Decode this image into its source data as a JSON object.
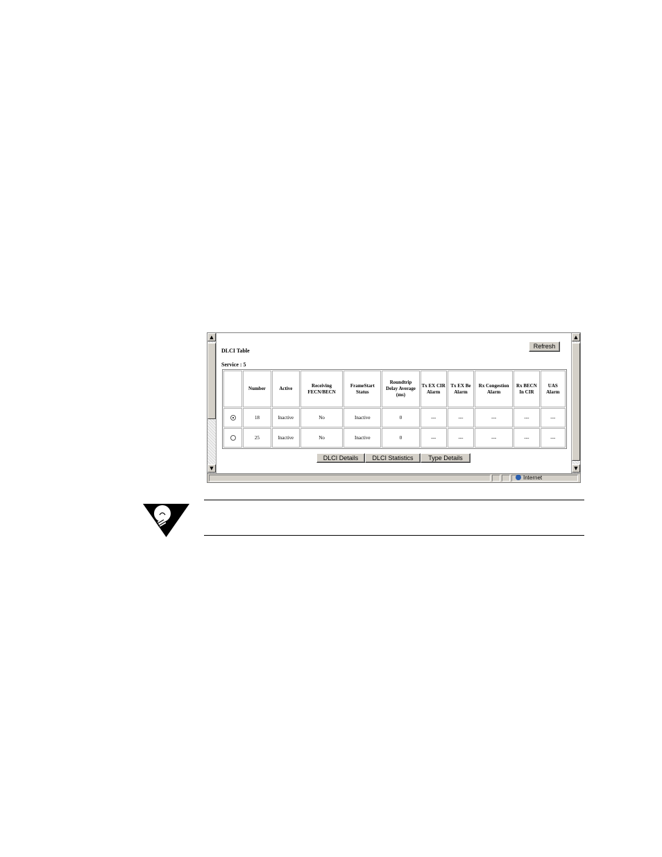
{
  "window": {
    "title": "DLCI Table",
    "service_label": "Service : 5",
    "refresh_label": "Refresh",
    "status_zone": "Internet"
  },
  "table": {
    "headers": [
      "",
      "Number",
      "Active",
      "Receiving FECN/BECN",
      "FrameStart Status",
      "Roundtrip Delay Average (ms)",
      "Tx EX CIR Alarm",
      "Tx EX Be Alarm",
      "Rx Congestion Alarm",
      "Rx BECN In CIR",
      "UAS Alarm"
    ],
    "rows": [
      {
        "selected": true,
        "number": "18",
        "active": "Inactive",
        "fecn": "No",
        "framestart": "Inactive",
        "delay": "0",
        "tx_cir": "---",
        "tx_be": "---",
        "rx_cong": "---",
        "rx_becn": "---",
        "uas": "---"
      },
      {
        "selected": false,
        "number": "25",
        "active": "Inactive",
        "fecn": "No",
        "framestart": "Inactive",
        "delay": "0",
        "tx_cir": "---",
        "tx_be": "---",
        "rx_cong": "---",
        "rx_becn": "---",
        "uas": "---"
      }
    ]
  },
  "buttons": {
    "dlci_details": "DLCI Details",
    "dlci_statistics": "DLCI Statistics",
    "type_details": "Type Details"
  },
  "scroll": {
    "up": "▲",
    "down": "▼"
  },
  "colors": {
    "chrome": "#d4d0c8",
    "globe": "#2a5fb0"
  },
  "icons": {
    "note": "lightbulb-icon",
    "status": "globe-icon"
  }
}
